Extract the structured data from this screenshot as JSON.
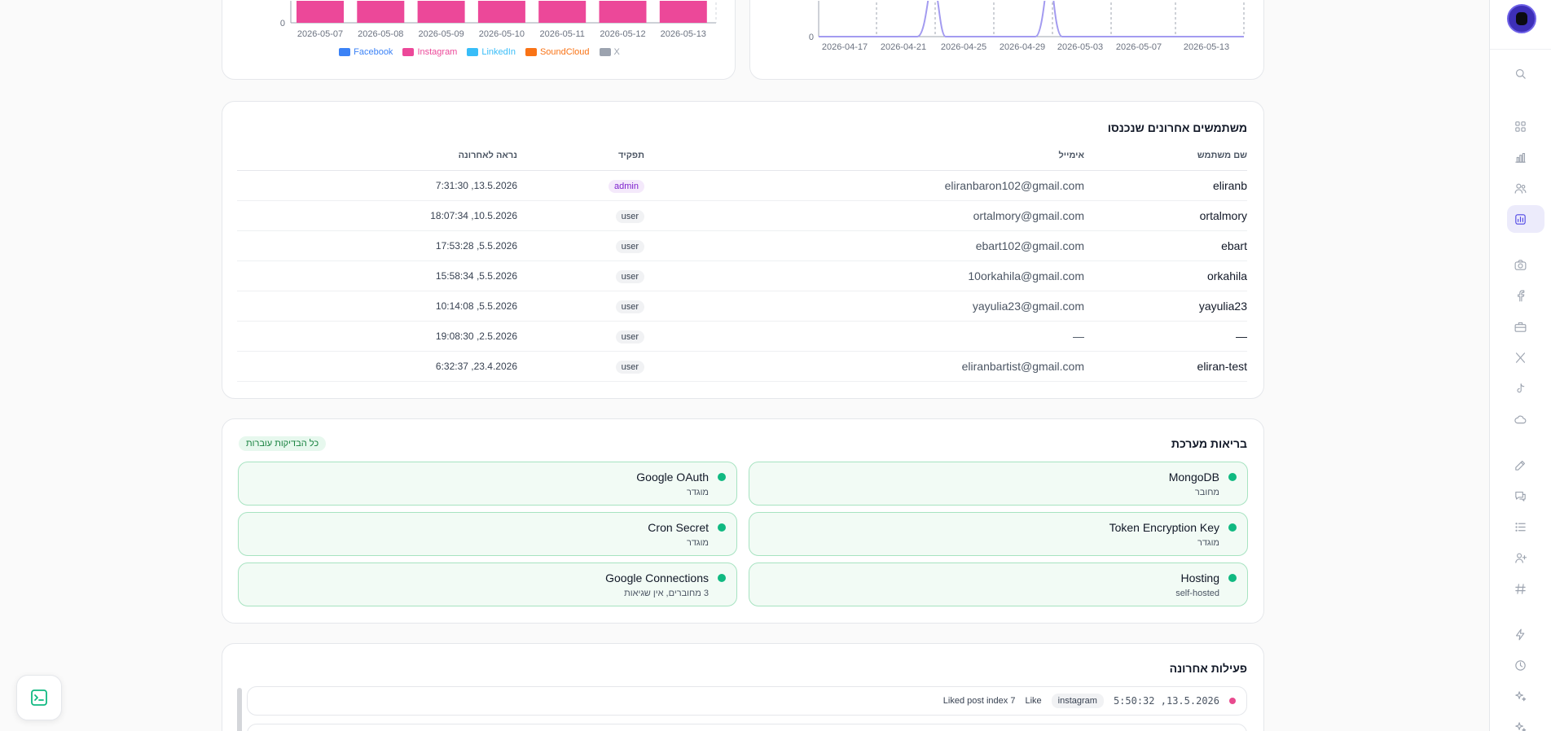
{
  "colors": {
    "accent": "#4f46e5",
    "facebook": "#3b82f6",
    "instagram": "#ec4899",
    "linkedin": "#38bdf8",
    "soundcloud": "#f97316",
    "x": "#9ca3af",
    "line": "#a39bf0",
    "ok": "#10b981"
  },
  "chart_data": [
    {
      "type": "bar",
      "categories": [
        "2026-05-07",
        "2026-05-08",
        "2026-05-09",
        "2026-05-10",
        "2026-05-11",
        "2026-05-12",
        "2026-05-13"
      ],
      "series": [
        {
          "name": "Facebook",
          "values": [
            0,
            0,
            0,
            0,
            0,
            0,
            0
          ]
        },
        {
          "name": "Instagram",
          "values": [
            1,
            1,
            1,
            1,
            1,
            1,
            1
          ]
        },
        {
          "name": "LinkedIn",
          "values": [
            0,
            0,
            0,
            0,
            0,
            0,
            0
          ]
        },
        {
          "name": "SoundCloud",
          "values": [
            0,
            0,
            0,
            0,
            0,
            0,
            0
          ]
        },
        {
          "name": "X",
          "values": [
            0,
            0,
            0,
            0,
            0,
            0,
            0
          ]
        }
      ],
      "yticks": [
        "0"
      ],
      "legend": "bottom"
    },
    {
      "type": "line",
      "x": [
        "2026-04-17",
        "2026-04-21",
        "2026-04-25",
        "2026-04-29",
        "2026-05-03",
        "2026-05-07",
        "2026-05-13"
      ],
      "yticks": [
        "0"
      ],
      "note_visible": "two peaks near 2026-04-21 and 2026-05-03, otherwise 0"
    }
  ],
  "users_card": {
    "title": "משתמשים אחרונים שנכנסו",
    "columns": [
      "שם משתמש",
      "אימייל",
      "תפקיד",
      "נראה לאחרונה"
    ],
    "rows": [
      {
        "username": "eliranb",
        "email": "eliranbaron102@gmail.com",
        "role": "admin",
        "last_seen": "13.5.2026, 7:31:30"
      },
      {
        "username": "ortalmory",
        "email": "ortalmory@gmail.com",
        "role": "user",
        "last_seen": "10.5.2026, 18:07:34"
      },
      {
        "username": "ebart",
        "email": "ebart102@gmail.com",
        "role": "user",
        "last_seen": "5.5.2026, 17:53:28"
      },
      {
        "username": "orkahila",
        "email": "10orkahila@gmail.com",
        "role": "user",
        "last_seen": "5.5.2026, 15:58:34"
      },
      {
        "username": "yayulia23",
        "email": "yayulia23@gmail.com",
        "role": "user",
        "last_seen": "5.5.2026, 10:14:08"
      },
      {
        "username": "—",
        "email": "—",
        "role": "user",
        "last_seen": "2.5.2026, 19:08:30"
      },
      {
        "username": "eliran-test",
        "email": "eliranbartist@gmail.com",
        "role": "user",
        "last_seen": "23.4.2026, 6:32:37"
      }
    ]
  },
  "health_card": {
    "title": "בריאות מערכת",
    "badge": "כל הבדיקות עוברות",
    "items": [
      {
        "name": "MongoDB",
        "status": "מחובר"
      },
      {
        "name": "Google OAuth",
        "status": "מוגדר"
      },
      {
        "name": "Token Encryption Key",
        "status": "מוגדר"
      },
      {
        "name": "Cron Secret",
        "status": "מוגדר"
      },
      {
        "name": "Hosting",
        "status": "self-hosted"
      },
      {
        "name": "Google Connections",
        "status": "3 מחוברים, אין שגיאות"
      }
    ]
  },
  "activity_card": {
    "title": "פעילות אחרונה",
    "items": [
      {
        "time": "13.5.2026, 5:50:32",
        "platform": "instagram",
        "action": "Like",
        "detail": "Liked post index 7"
      }
    ]
  },
  "sidebar": {
    "icons": [
      "search-icon",
      "grid-icon",
      "bar-chart-icon",
      "users-icon",
      "analytics-icon",
      "camera-icon",
      "facebook-icon",
      "briefcase-icon",
      "x-icon",
      "tiktok-icon",
      "cloud-icon",
      "edit-icon",
      "chat-icon",
      "list-icon",
      "user-plus-icon",
      "hash-icon",
      "bolt-icon",
      "clock-icon",
      "sparkles-icon",
      "sparkles-icon"
    ]
  }
}
